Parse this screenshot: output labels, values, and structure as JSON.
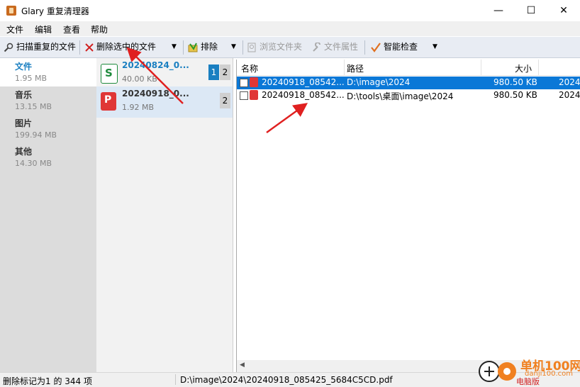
{
  "window": {
    "title": "Glary 重复清理器",
    "minimize": "—",
    "maximize": "☐",
    "close": "✕"
  },
  "menubar": [
    "文件",
    "编辑",
    "查看",
    "帮助"
  ],
  "toolbar": {
    "scan_label": "扫描重复的文件",
    "delete_label": "删除选中的文件",
    "exclude_label": "排除",
    "browse_label": "浏览文件夹",
    "props_label": "文件属性",
    "smart_label": "智能检查"
  },
  "categories": [
    {
      "name": "文件",
      "size": "1.95 MB"
    },
    {
      "name": "音乐",
      "size": "13.15 MB"
    },
    {
      "name": "图片",
      "size": "199.94 MB"
    },
    {
      "name": "其他",
      "size": "14.30 MB"
    }
  ],
  "groups": [
    {
      "name": "20240824_0...",
      "size": "40.00 KB",
      "badge_active": "1",
      "badge": "2"
    },
    {
      "name": "20240918_0...",
      "size": "1.92 MB",
      "badge": "2"
    }
  ],
  "file_table": {
    "headers": {
      "name": "名称",
      "path": "路径",
      "size": "大小"
    },
    "rows": [
      {
        "name": "20240918_08542...",
        "path": "D:\\image\\2024",
        "size": "980.50 KB",
        "date": "2024"
      },
      {
        "name": "20240918_08542...",
        "path": "D:\\tools\\桌面\\image\\2024",
        "size": "980.50 KB",
        "date": "2024"
      }
    ]
  },
  "statusbar": {
    "marked": "删除标记为1 的 344 项",
    "path": "D:\\image\\2024\\20240918_085425_5684C5CD.pdf"
  },
  "watermark": {
    "line1": "单机100网",
    "line2": "danji100.com",
    "line3": "电脑版"
  },
  "colors": {
    "accent": "#1a7fc1",
    "selection": "#0a78d7",
    "arrow": "#e02020"
  }
}
